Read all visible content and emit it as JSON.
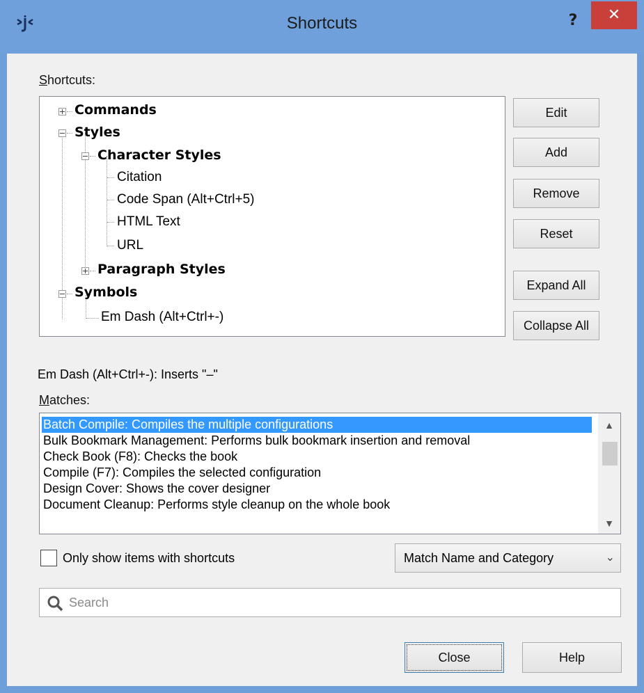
{
  "window": {
    "title": "Shortcuts",
    "help_label": "?",
    "close_label": "✕"
  },
  "labels": {
    "shortcuts": "Shortcuts:",
    "matches": "Matches:"
  },
  "tree": {
    "commands": "Commands",
    "styles": "Styles",
    "character_styles": "Character Styles",
    "citation": "Citation",
    "code_span": "Code Span (Alt+Ctrl+5)",
    "html_text": "HTML Text",
    "url": "URL",
    "paragraph_styles": "Paragraph Styles",
    "symbols": "Symbols",
    "em_dash": "Em Dash (Alt+Ctrl+-)"
  },
  "buttons": {
    "edit": "Edit",
    "add": "Add",
    "remove": "Remove",
    "reset": "Reset",
    "expand_all": "Expand All",
    "collapse_all": "Collapse All",
    "close": "Close",
    "help": "Help"
  },
  "description": "Em Dash (Alt+Ctrl+-): Inserts \"–\"",
  "matches": [
    "Batch Compile: Compiles the multiple configurations",
    "Bulk Bookmark Management: Performs bulk bookmark insertion and removal",
    "Check Book (F8): Checks the book",
    "Compile (F7): Compiles the selected configuration",
    "Design Cover: Shows the cover designer",
    "Document Cleanup: Performs style cleanup on the whole book"
  ],
  "filter": {
    "only_shortcuts_label": "Only show items with shortcuts",
    "only_shortcuts_checked": false,
    "match_mode": "Match Name and Category"
  },
  "search": {
    "placeholder": "Search"
  },
  "colors": {
    "titlebar": "#6fa0db",
    "close": "#c9403b",
    "selection": "#3399ff"
  }
}
